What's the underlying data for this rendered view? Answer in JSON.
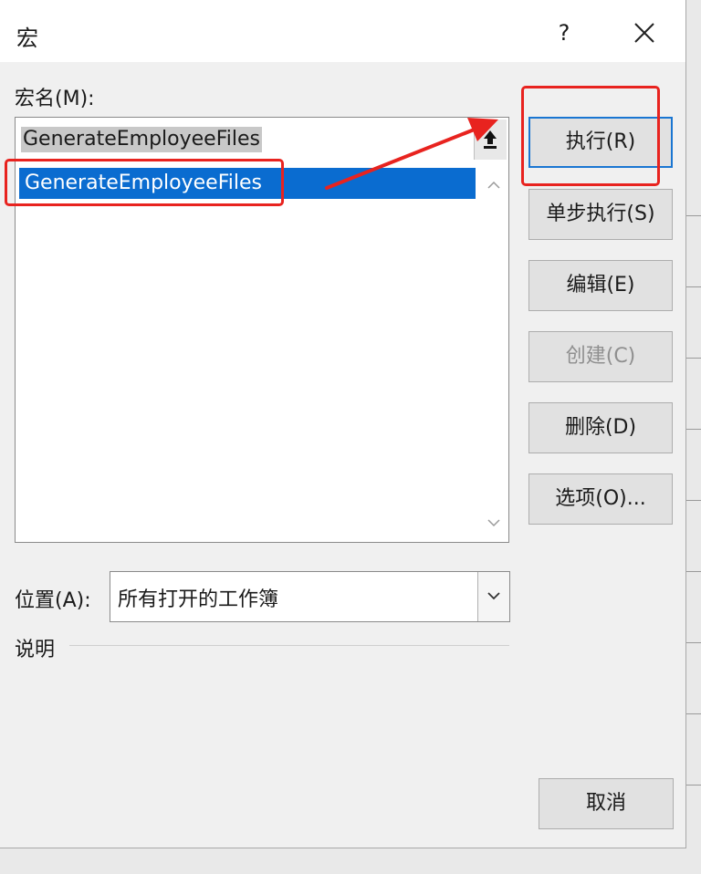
{
  "dialog": {
    "title": "宏",
    "help": "?",
    "macro_name_label": "宏名(M):",
    "macro_name_value": "GenerateEmployeeFiles",
    "macro_list": [
      "GenerateEmployeeFiles"
    ],
    "location_label": "位置(A):",
    "location_value": "所有打开的工作簿",
    "description_label": "说明"
  },
  "buttons": {
    "run": "执行(R)",
    "step_into": "单步执行(S)",
    "edit": "编辑(E)",
    "create": "创建(C)",
    "delete": "删除(D)",
    "options": "选项(O)...",
    "cancel": "取消"
  },
  "colors": {
    "selection": "#0a6cd0",
    "annotation": "#e8231f",
    "primary_border": "#1a76d2"
  }
}
